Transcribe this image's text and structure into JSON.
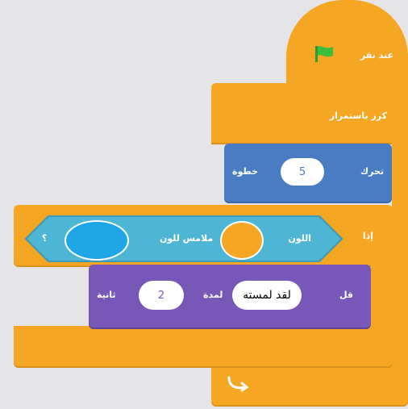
{
  "hat": {
    "label": "عند نقر"
  },
  "forever": {
    "label": "كرر باستمرار"
  },
  "move": {
    "prefix": "تحرك",
    "value": "5",
    "suffix": "خطوة"
  },
  "if_block": {
    "label": "إذا"
  },
  "sensing": {
    "color_label": "اللون",
    "middle": "ملامس للون",
    "question": "؟"
  },
  "say": {
    "label": "قل",
    "message": "لقد لمسته",
    "for_label": "لمدة",
    "seconds": "2",
    "unit": "ثانية"
  },
  "colors": {
    "events": "#f5a623",
    "motion": "#4a7cc4",
    "looks": "#7758b8",
    "sensing": "#4fb5d4",
    "flag": "#3dbd3d",
    "swatch_orange": "#f5a623",
    "swatch_blue": "#1fa6e6"
  },
  "icons": {
    "flag": "green-flag-icon",
    "loop": "loop-arrow-icon"
  }
}
